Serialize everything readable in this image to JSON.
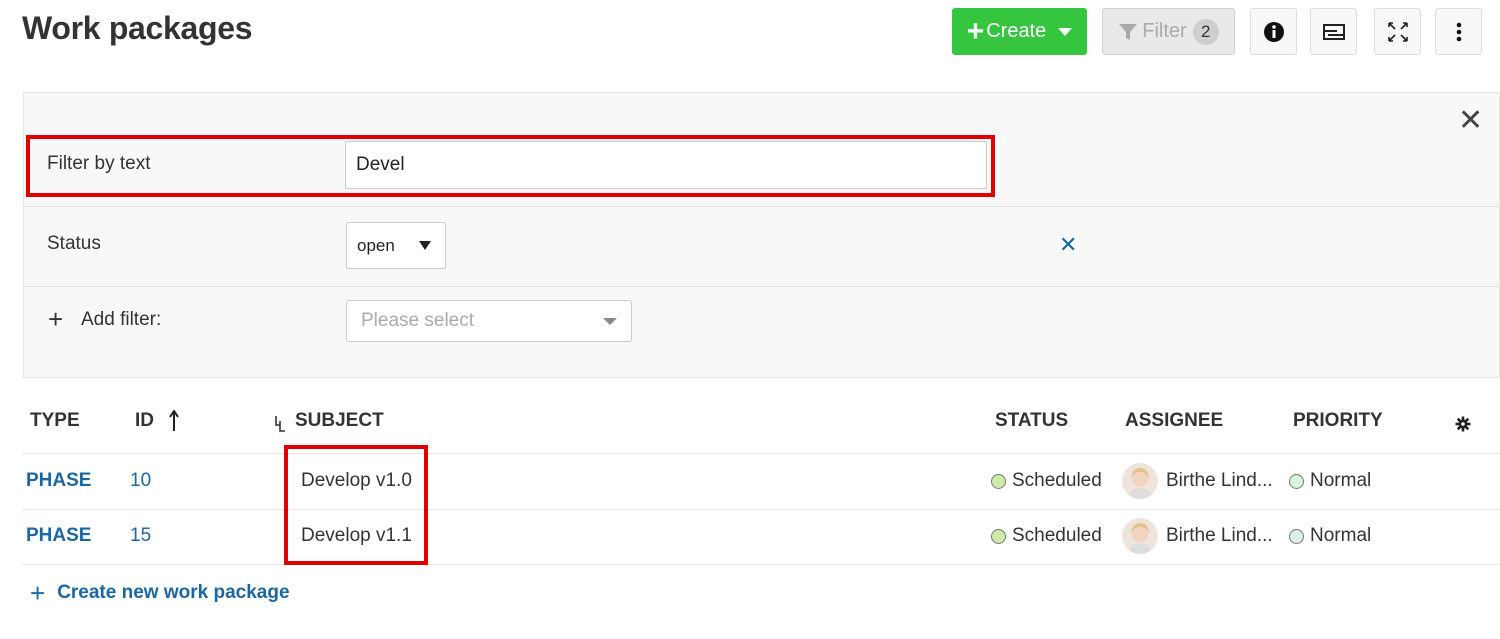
{
  "header": {
    "title": "Work packages"
  },
  "toolbar": {
    "create_label": "Create",
    "filter_label": "Filter",
    "filter_count": "2",
    "icons": [
      "info-icon",
      "view-mode-icon",
      "fullscreen-icon",
      "more-icon"
    ]
  },
  "filters": {
    "text_label": "Filter by text",
    "text_value": "Devel",
    "status_label": "Status",
    "status_value": "open",
    "add_label": "Add filter:",
    "add_placeholder": "Please select"
  },
  "table": {
    "columns": [
      "TYPE",
      "ID",
      "SUBJECT",
      "STATUS",
      "ASSIGNEE",
      "PRIORITY"
    ],
    "rows": [
      {
        "type": "PHASE",
        "id": "10",
        "subject": "Develop v1.0",
        "status": "Scheduled",
        "assignee": "Birthe Lind...",
        "priority": "Normal"
      },
      {
        "type": "PHASE",
        "id": "15",
        "subject": "Develop v1.1",
        "status": "Scheduled",
        "assignee": "Birthe Lind...",
        "priority": "Normal"
      }
    ]
  },
  "footer": {
    "create_link": "Create new work package"
  },
  "colors": {
    "accent": "#35c53f",
    "link": "#1a67a3",
    "highlight": "#e10000"
  }
}
